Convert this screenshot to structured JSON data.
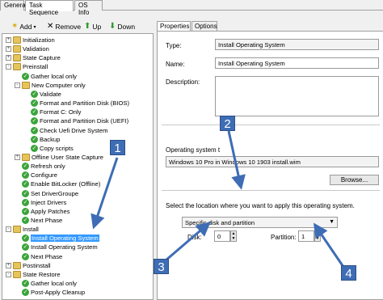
{
  "top_tabs": [
    "General",
    "Task Sequence",
    "OS Info"
  ],
  "toolbar": {
    "add": "Add",
    "remove": "Remove",
    "up": "Up",
    "down": "Down"
  },
  "tree": [
    {
      "label": "Initialization",
      "icon": "folder",
      "level": 1,
      "expander": "+"
    },
    {
      "label": "Validation",
      "icon": "folder",
      "level": 1,
      "expander": "+"
    },
    {
      "label": "State Capture",
      "icon": "folder",
      "level": 1,
      "expander": "+"
    },
    {
      "label": "Preinstall",
      "icon": "folder",
      "level": 1,
      "expander": "-"
    },
    {
      "label": "Gather local only",
      "icon": "check",
      "level": 2
    },
    {
      "label": "New Computer only",
      "icon": "folder",
      "level": 2,
      "expander": "-"
    },
    {
      "label": "Validate",
      "icon": "check",
      "level": 3
    },
    {
      "label": "Format and Partition Disk (BIOS)",
      "icon": "check",
      "level": 3
    },
    {
      "label": "Format C: Only",
      "icon": "check",
      "level": 3
    },
    {
      "label": "Format and Partition Disk (UEFI)",
      "icon": "check",
      "level": 3
    },
    {
      "label": "Check Uefi Drive System",
      "icon": "check",
      "level": 3
    },
    {
      "label": "Backup",
      "icon": "check",
      "level": 3
    },
    {
      "label": "Copy scripts",
      "icon": "check",
      "level": 3
    },
    {
      "label": "Offline User State Capture",
      "icon": "folder",
      "level": 2,
      "expander": "+"
    },
    {
      "label": "Refresh only",
      "icon": "check",
      "level": 2
    },
    {
      "label": "Configure",
      "icon": "check",
      "level": 2
    },
    {
      "label": "Enable BitLocker (Offline)",
      "icon": "check",
      "level": 2
    },
    {
      "label": "Set DriverGroupe",
      "icon": "check",
      "level": 2
    },
    {
      "label": "Inject Drivers",
      "icon": "check",
      "level": 2
    },
    {
      "label": "Apply Patches",
      "icon": "check",
      "level": 2
    },
    {
      "label": "Next Phase",
      "icon": "check",
      "level": 2
    },
    {
      "label": "Install",
      "icon": "folder",
      "level": 1,
      "expander": "-"
    },
    {
      "label": "Install Operating System",
      "icon": "check",
      "level": 2,
      "selected": true
    },
    {
      "label": "Install Operating System",
      "icon": "check",
      "level": 2
    },
    {
      "label": "Next Phase",
      "icon": "check",
      "level": 2
    },
    {
      "label": "Postinstall",
      "icon": "folder",
      "level": 1,
      "expander": "+"
    },
    {
      "label": "State Restore",
      "icon": "folder",
      "level": 1,
      "expander": "-"
    },
    {
      "label": "Gather local only",
      "icon": "check",
      "level": 2
    },
    {
      "label": "Post-Apply Cleanup",
      "icon": "check",
      "level": 2
    }
  ],
  "props": {
    "tabs": [
      "Properties",
      "Options"
    ],
    "type_label": "Type:",
    "type_value": "Install Operating System",
    "name_label": "Name:",
    "name_value": "Install Operating System",
    "description_label": "Description:",
    "os_label": "Operating system t",
    "os_value": "Windows 10 Pro in Windows 10 1903 install.wim",
    "browse": "Browse...",
    "location_label": "Select the location where you want to apply this operating system.",
    "location_value": "Specific disk and partition",
    "disk_label": "Disk:",
    "disk_value": "0",
    "partition_label": "Partition:",
    "partition_value": "1"
  },
  "callouts": [
    "1",
    "2",
    "3",
    "4"
  ],
  "colors": {
    "callout": "#3e6db5",
    "selection": "#3399ff"
  }
}
